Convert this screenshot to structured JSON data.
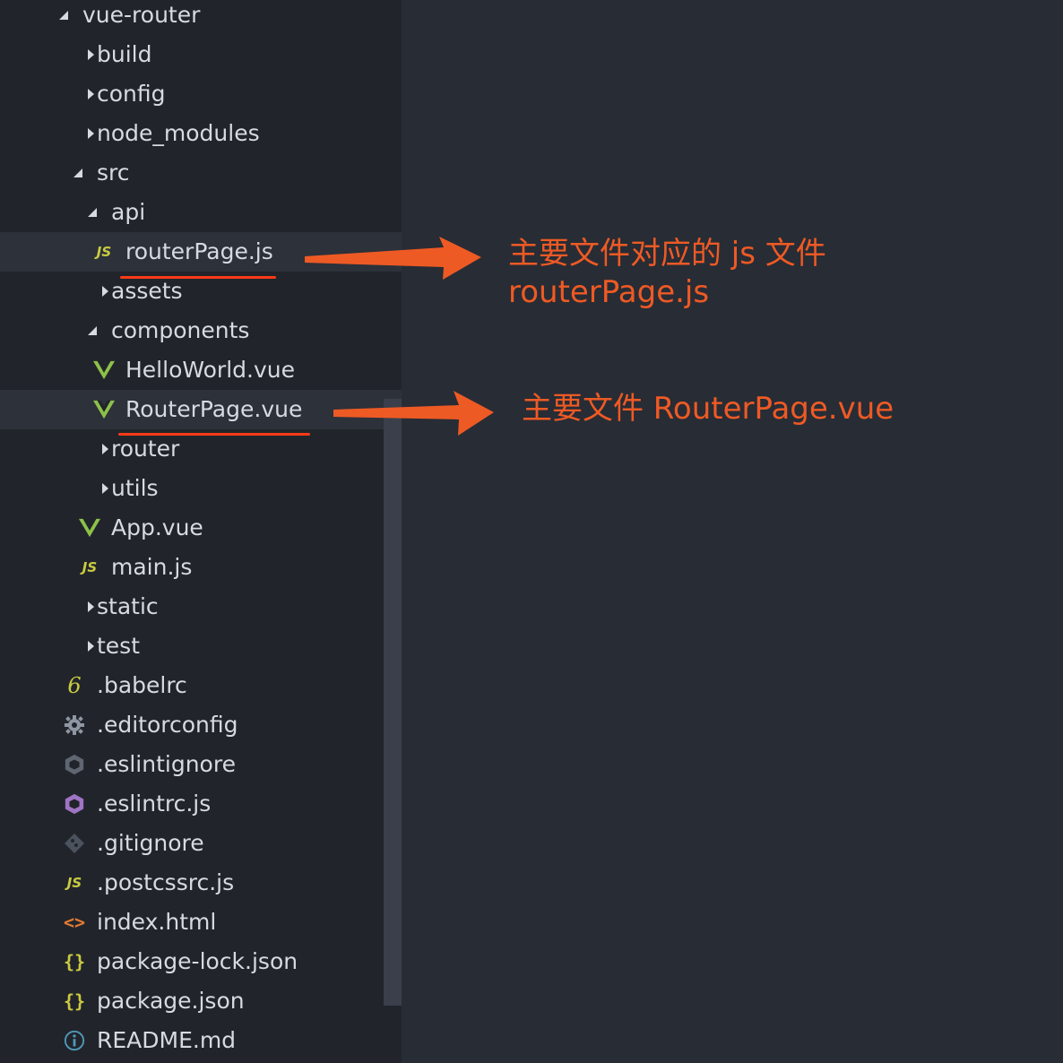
{
  "tree": [
    {
      "label": "vue-router",
      "kind": "folder-open"
    },
    {
      "label": "build",
      "kind": "folder"
    },
    {
      "label": "config",
      "kind": "folder"
    },
    {
      "label": "node_modules",
      "kind": "folder"
    },
    {
      "label": "src",
      "kind": "folder-open"
    },
    {
      "label": "api",
      "kind": "folder-open"
    },
    {
      "label": "routerPage.js",
      "kind": "js"
    },
    {
      "label": "assets",
      "kind": "folder"
    },
    {
      "label": "components",
      "kind": "folder-open"
    },
    {
      "label": "HelloWorld.vue",
      "kind": "vue"
    },
    {
      "label": "RouterPage.vue",
      "kind": "vue"
    },
    {
      "label": "router",
      "kind": "folder"
    },
    {
      "label": "utils",
      "kind": "folder"
    },
    {
      "label": "App.vue",
      "kind": "vue"
    },
    {
      "label": "main.js",
      "kind": "js"
    },
    {
      "label": "static",
      "kind": "folder"
    },
    {
      "label": "test",
      "kind": "folder"
    },
    {
      "label": ".babelrc",
      "kind": "babel"
    },
    {
      "label": ".editorconfig",
      "kind": "gear"
    },
    {
      "label": ".eslintignore",
      "kind": "eslint-gray"
    },
    {
      "label": ".eslintrc.js",
      "kind": "eslint"
    },
    {
      "label": ".gitignore",
      "kind": "git"
    },
    {
      "label": ".postcssrc.js",
      "kind": "js"
    },
    {
      "label": "index.html",
      "kind": "html"
    },
    {
      "label": "package-lock.json",
      "kind": "json"
    },
    {
      "label": "package.json",
      "kind": "json"
    },
    {
      "label": "README.md",
      "kind": "info"
    }
  ],
  "icons": {
    "js_text": "JS",
    "babel_text": "6",
    "json_text": "{}",
    "html_text": "<>"
  },
  "annotations": {
    "js_line1": "主要文件对应的 js 文件",
    "js_line2": "routerPage.js",
    "vue_line": "主要文件 RouterPage.vue"
  },
  "colors": {
    "sidebar_bg": "#21252b",
    "editor_bg": "#282c35",
    "text": "#d7dae0",
    "vue_green": "#8dc149",
    "js_yellow": "#cbcb41",
    "annotation_orange": "#ee5a24",
    "underline_red": "#ff3b17"
  }
}
